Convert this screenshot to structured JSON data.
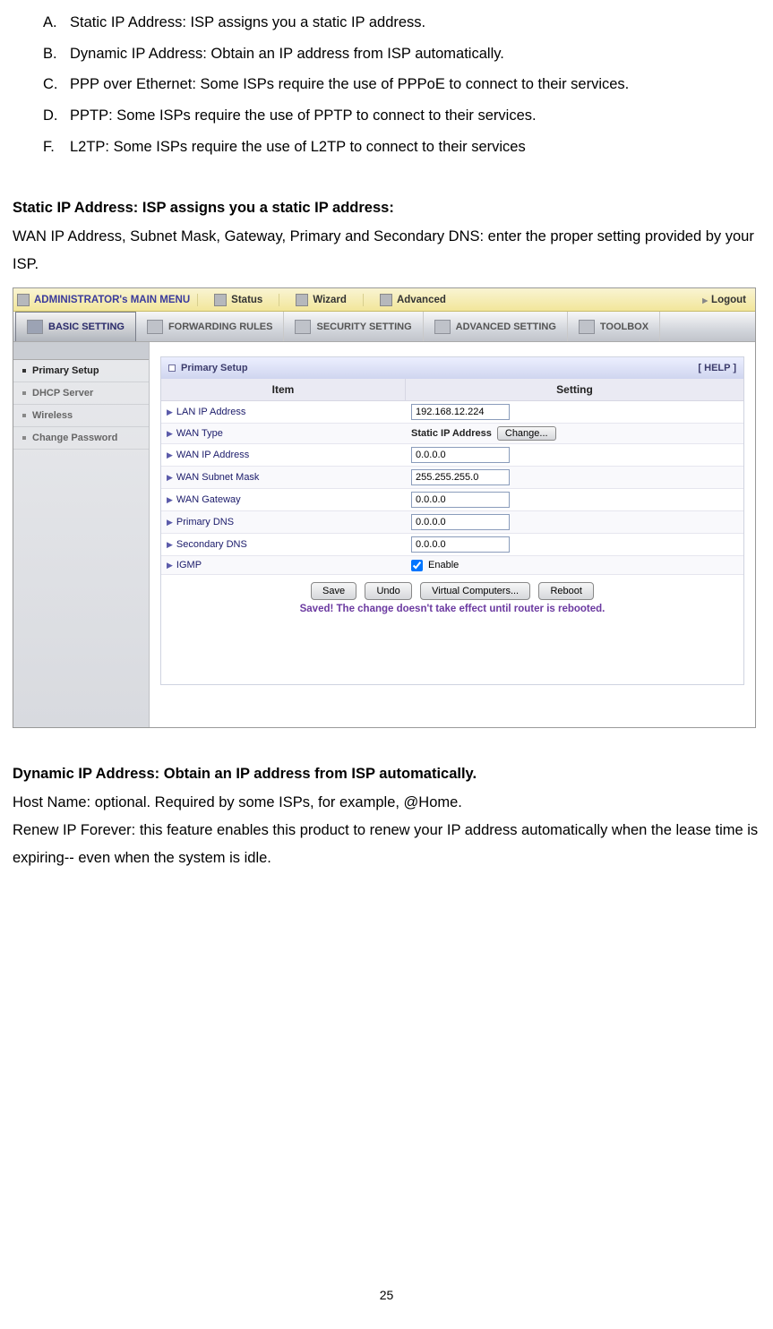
{
  "intro_list": [
    {
      "label": "A.",
      "text": "Static IP Address: ISP assigns you a static IP address."
    },
    {
      "label": "B.",
      "text": "Dynamic IP Address: Obtain an IP address from ISP automatically."
    },
    {
      "label": "C.",
      "text": "PPP over Ethernet: Some ISPs require the use of  PPPoE to connect to their services."
    },
    {
      "label": "D.",
      "text": "PPTP: Some ISPs require the use of    PPTP to connect to their services."
    },
    {
      "label": "F.",
      "text": "L2TP: Some ISPs require the use of    L2TP to connect to their services"
    }
  ],
  "section1": {
    "heading": "Static IP Address: ISP assigns you a static IP address:",
    "body": "WAN IP Address, Subnet Mask, Gateway, Primary and Secondary DNS: enter the proper setting provided by your ISP."
  },
  "router": {
    "topbar": {
      "admin_title": "ADMINISTRATOR's MAIN MENU",
      "tabs": [
        "Status",
        "Wizard",
        "Advanced"
      ],
      "logout": "Logout"
    },
    "navbar2": {
      "tabs": [
        "BASIC SETTING",
        "FORWARDING RULES",
        "SECURITY SETTING",
        "ADVANCED SETTING",
        "TOOLBOX"
      ]
    },
    "sidebar": {
      "items": [
        "Primary Setup",
        "DHCP Server",
        "Wireless",
        "Change Password"
      ]
    },
    "panel": {
      "title": "Primary Setup",
      "help": "[ HELP ]",
      "headers": {
        "item": "Item",
        "setting": "Setting"
      },
      "rows": {
        "lan_ip": {
          "label": "LAN IP Address",
          "value": "192.168.12.224"
        },
        "wan_type": {
          "label": "WAN Type",
          "value": "Static IP Address",
          "btn": "Change..."
        },
        "wan_ip": {
          "label": "WAN IP Address",
          "value": "0.0.0.0"
        },
        "wan_mask": {
          "label": "WAN Subnet Mask",
          "value": "255.255.255.0"
        },
        "wan_gw": {
          "label": "WAN Gateway",
          "value": "0.0.0.0"
        },
        "pri_dns": {
          "label": "Primary DNS",
          "value": "0.0.0.0"
        },
        "sec_dns": {
          "label": "Secondary DNS",
          "value": "0.0.0.0"
        },
        "igmp": {
          "label": "IGMP",
          "enable_label": "Enable",
          "checked": true
        }
      },
      "buttons": {
        "save": "Save",
        "undo": "Undo",
        "vc": "Virtual Computers...",
        "reboot": "Reboot"
      },
      "saved_msg": "Saved! The change doesn't take effect until router is rebooted."
    }
  },
  "section2": {
    "heading": "Dynamic IP Address: Obtain an IP address from ISP automatically.",
    "body1": "Host Name: optional. Required by some ISPs, for example, @Home.",
    "body2": "Renew IP Forever: this feature enables this product to renew your IP address automatically when the lease time is expiring-- even when the system is idle."
  },
  "page_num": "25"
}
